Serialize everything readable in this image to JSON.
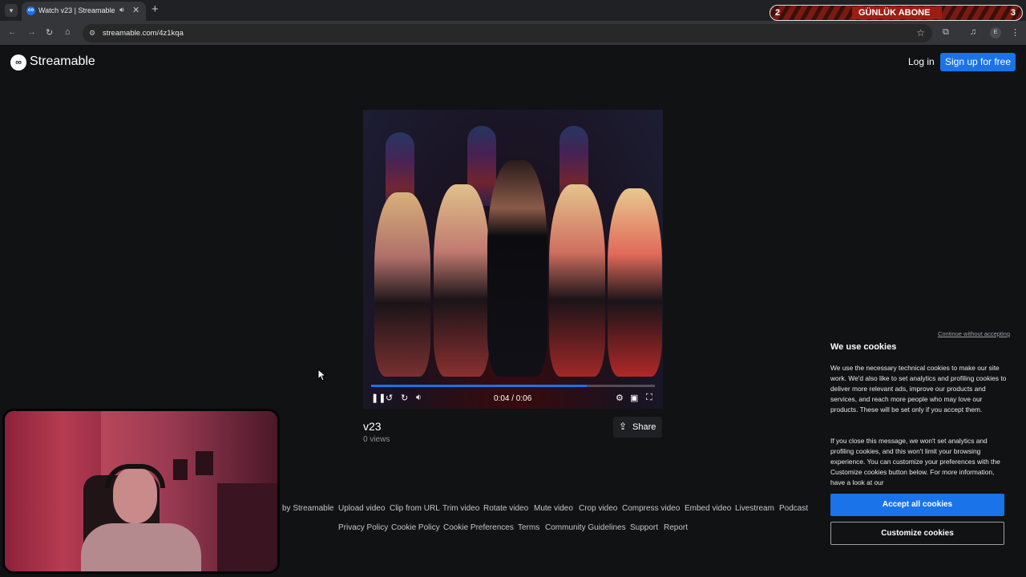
{
  "browser": {
    "tab_title": "Watch v23 | Streamable",
    "tab_favicon": "co",
    "url": "streamable.com/4z1kqa",
    "profile_initial": "E"
  },
  "stream_overlay": {
    "left_number": "2",
    "title": "GÜNLÜK ABONE",
    "right_number": "3"
  },
  "header": {
    "logo_text": "Streamable",
    "login_label": "Log in",
    "signup_label": "Sign up for free"
  },
  "video": {
    "time_display": "0:04 / 0:06",
    "progress_fraction": 0.76,
    "title": "v23",
    "views": "0 views",
    "share_label": "Share"
  },
  "footer": {
    "row1": [
      "by Streamable",
      "Upload video",
      "Clip from URL",
      "Trim video",
      "Rotate video",
      "Mute video",
      "Crop video",
      "Compress video",
      "Embed video",
      "Livestream",
      "Podcast"
    ],
    "row2": [
      "Privacy Policy",
      "Cookie Policy",
      "Cookie Preferences",
      "Terms",
      "Community Guidelines",
      "Support",
      "Report"
    ]
  },
  "cookie": {
    "skip_label": "Continue without accepting",
    "title": "We use cookies",
    "text1": "We use the necessary technical cookies to make our site work. We'd also like to set analytics and profiling cookies to deliver more relevant ads, improve our products and services, and reach more people who may love our products. These will be set only if you accept them.",
    "text2": "If you close this message, we won't set analytics and profiling cookies, and this won't limit your browsing experience. You can customize your preferences with the Customize cookies button below. For more information, have a look at our",
    "accept_label": "Accept all cookies",
    "customize_label": "Customize cookies"
  }
}
